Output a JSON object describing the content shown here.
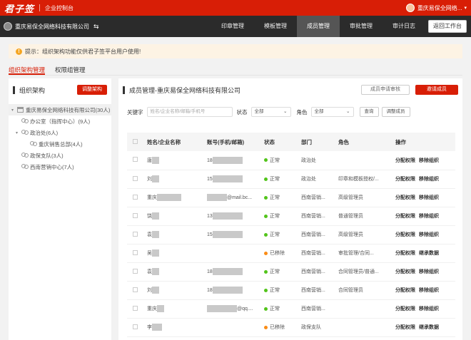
{
  "topbar": {
    "logo": "君子签",
    "title": "企业控制台",
    "user": "重庆易保全网络..."
  },
  "header": {
    "company": "重庆易保全网络科技有限公司",
    "swap_icon": "⇆",
    "tabs": [
      {
        "label": "印章管理",
        "active": false
      },
      {
        "label": "模板管理",
        "active": false
      },
      {
        "label": "成员管理",
        "active": true
      },
      {
        "label": "审批管理",
        "active": false
      },
      {
        "label": "审计日志",
        "active": false
      }
    ],
    "back_label": "返回工作台"
  },
  "notice": {
    "prefix": "提示：",
    "text": "组织架构功能仅供君子签平台用户使用!"
  },
  "subtabs": [
    {
      "label": "组织架构管理",
      "active": true
    },
    {
      "label": "权限组管理",
      "active": false
    }
  ],
  "left": {
    "title": "组织架构",
    "adjust_btn": "调整架构",
    "tree": [
      {
        "label": "重庆易保全网络科技有限公司(30人)",
        "level": 0,
        "icon": "org",
        "expanded": true
      },
      {
        "label": "办公室（指挥中心）(9人)",
        "level": 1,
        "icon": "people"
      },
      {
        "label": "政治处(6人)",
        "level": 1,
        "icon": "people",
        "expanded": true
      },
      {
        "label": "重庆销售总部(4人)",
        "level": 2,
        "icon": "people"
      },
      {
        "label": "政保支队(3人)",
        "level": 1,
        "icon": "people"
      },
      {
        "label": "西南营销中心(7人)",
        "level": 1,
        "icon": "people"
      }
    ]
  },
  "right": {
    "title": "成员管理-重庆易保全网络科技有限公司",
    "apply_btn": "成员申请审核",
    "invite_btn": "邀请成员",
    "filter": {
      "keyword_label": "关键字",
      "keyword_placeholder": "姓名/企业名称/邮箱/手机号",
      "status_label": "状态",
      "status_value": "全部",
      "role_label": "角色",
      "role_value": "全部",
      "search_btn": "查询",
      "adjust_btn": "调整成员"
    },
    "columns": [
      "姓名/企业名称",
      "账号(手机/邮箱)",
      "状态",
      "部门",
      "角色",
      "操作"
    ],
    "rows": [
      {
        "name": "唐",
        "account": "18",
        "status": "正常",
        "status_color": "#52c41a",
        "dept": "政治处",
        "role": "",
        "actions": [
          "分配权限",
          "移除组织"
        ]
      },
      {
        "name": "刘",
        "account": "15",
        "status": "正常",
        "status_color": "#52c41a",
        "dept": "政治处",
        "role": "印章和模板授权/...",
        "actions": [
          "分配权限",
          "移除组织"
        ]
      },
      {
        "name": "重庆",
        "account": "@mail.bc...",
        "status": "正常",
        "status_color": "#52c41a",
        "dept": "西南营销...",
        "role": "高级管理员",
        "actions": [
          "分配权限",
          "移除组织"
        ]
      },
      {
        "name": "饶",
        "account": "13",
        "status": "正常",
        "status_color": "#52c41a",
        "dept": "西南营销...",
        "role": "普通管理员",
        "actions": [
          "分配权限",
          "移除组织"
        ]
      },
      {
        "name": "袁",
        "account": "15",
        "status": "正常",
        "status_color": "#52c41a",
        "dept": "西南营销...",
        "role": "高级管理员",
        "actions": [
          "分配权限",
          "移除组织"
        ]
      },
      {
        "name": "吴",
        "account": "",
        "status": "已移除",
        "status_color": "#fa8c16",
        "dept": "西南营销...",
        "role": "审批管理/合同...",
        "actions": [
          "分配权限",
          "继承数据"
        ]
      },
      {
        "name": "袁",
        "account": "18",
        "status": "正常",
        "status_color": "#52c41a",
        "dept": "西南营销...",
        "role": "合同管理员/普通...",
        "actions": [
          "分配权限",
          "移除组织"
        ]
      },
      {
        "name": "刘",
        "account": "18",
        "status": "正常",
        "status_color": "#52c41a",
        "dept": "西南营销...",
        "role": "合同管理员",
        "actions": [
          "分配权限",
          "移除组织"
        ]
      },
      {
        "name": "重庆",
        "account": "@qq....",
        "status": "正常",
        "status_color": "#52c41a",
        "dept": "西南营销...",
        "role": "",
        "actions": [
          "分配权限",
          "移除组织"
        ]
      },
      {
        "name": "李",
        "account": "",
        "status": "已移除",
        "status_color": "#fa8c16",
        "dept": "政保支队",
        "role": "",
        "actions": [
          "分配权限",
          "继承数据"
        ]
      }
    ]
  }
}
